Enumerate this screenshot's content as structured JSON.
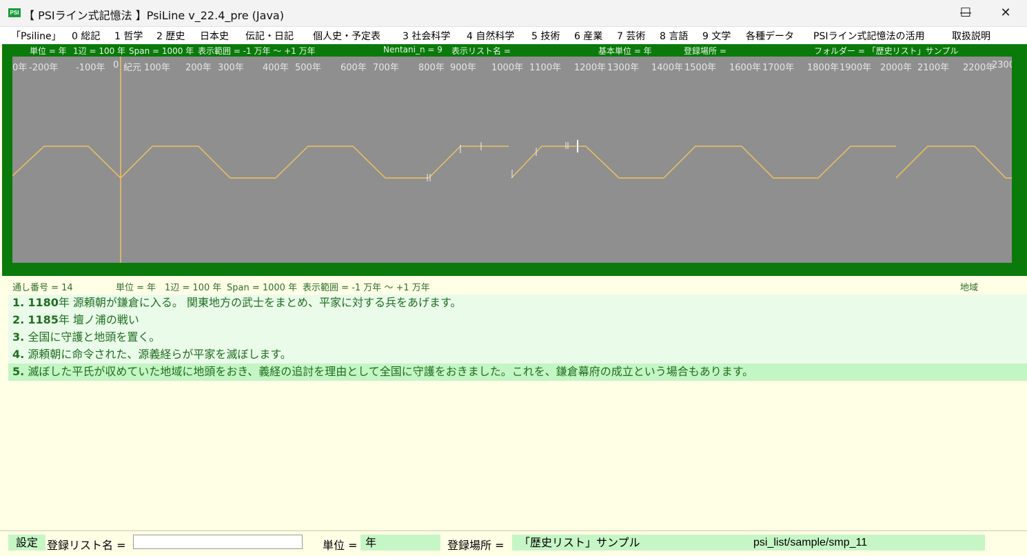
{
  "window": {
    "icon_label": "PSI",
    "title": "【 PSIライン式記憶法 】PsiLine v_22.4_pre (Java)",
    "minimize": "—",
    "maximize": "☐",
    "close": "✕"
  },
  "menu": [
    "「Psiline」",
    "0 総記",
    "1 哲学",
    "2 歴史",
    "日本史",
    "伝記・日記",
    "個人史・予定表",
    "3 社会科学",
    "4 自然科学",
    "5 技術",
    "6 産業",
    "7 芸術",
    "8 言語",
    "9 文学",
    "各種データ",
    "PSIライン式記憶法の活用",
    "取扱説明"
  ],
  "info_line": {
    "unit": "単位 = 年",
    "side": "1辺 = 100 年",
    "span": "Span = 1000 年",
    "range": "表示範囲 = -1 万年 ～ +1 万年",
    "nentani": "Nentani_n = 9",
    "list_name": "表示リスト名 =",
    "base_unit": "基本単位 = 年",
    "location": "登録場所 =",
    "folder": "フォルダー = 「歴史リスト」サンプル"
  },
  "year_ticks": [
    "0年",
    "-200年",
    "-100年",
    "0",
    "紀元",
    "100年",
    "200年",
    "300年",
    "400年",
    "500年",
    "600年",
    "700年",
    "800年",
    "900年",
    "1000年",
    "1100年",
    "1200年",
    "1300年",
    "1400年",
    "1500年",
    "1600年",
    "1700年",
    "1800年",
    "1900年",
    "2000年",
    "2100年",
    "2200年",
    "2300"
  ],
  "timeline": {
    "line_color": "#f0c060",
    "marker_color": "#ffffff",
    "background": "#8f8f8f",
    "frame": "#0a7a0a"
  },
  "lower_info": {
    "serial": "通し番号 = 14",
    "unit": "単位 = 年",
    "side": "1辺 = 100 年",
    "span": "Span = 1000 年",
    "range": "表示範囲 = -1 万年 ～ +1 万年",
    "region": "地域"
  },
  "events": [
    {
      "num": "1.",
      "year": "1180",
      "text": "年 源頼朝が鎌倉に入る。 関東地方の武士をまとめ、平家に対する兵をあげます。"
    },
    {
      "num": "2.",
      "year": "1185",
      "text": "年 壇ノ浦の戦い"
    },
    {
      "num": "3.",
      "year": "",
      "text": "全国に守護と地頭を置く。"
    },
    {
      "num": "4.",
      "year": "",
      "text": "源頼朝に命令された、源義経らが平家を滅ぼします。"
    },
    {
      "num": "5.",
      "year": "",
      "text": "滅ぼした平氏が収めていた地域に地頭をおき、義経の追討を理由として全国に守護をおきました。これを、鎌倉幕府の成立という場合もあります。"
    }
  ],
  "selected_event_index": 4,
  "statusbar": {
    "settings": "設定",
    "list_name_label": "登録リスト名 =",
    "list_name_value": "",
    "unit_label": "単位 =",
    "unit_value": "年",
    "location_label": "登録場所 =",
    "location_value": "「歴史リスト」サンプル",
    "path_value": "psi_list/sample/smp_11"
  }
}
